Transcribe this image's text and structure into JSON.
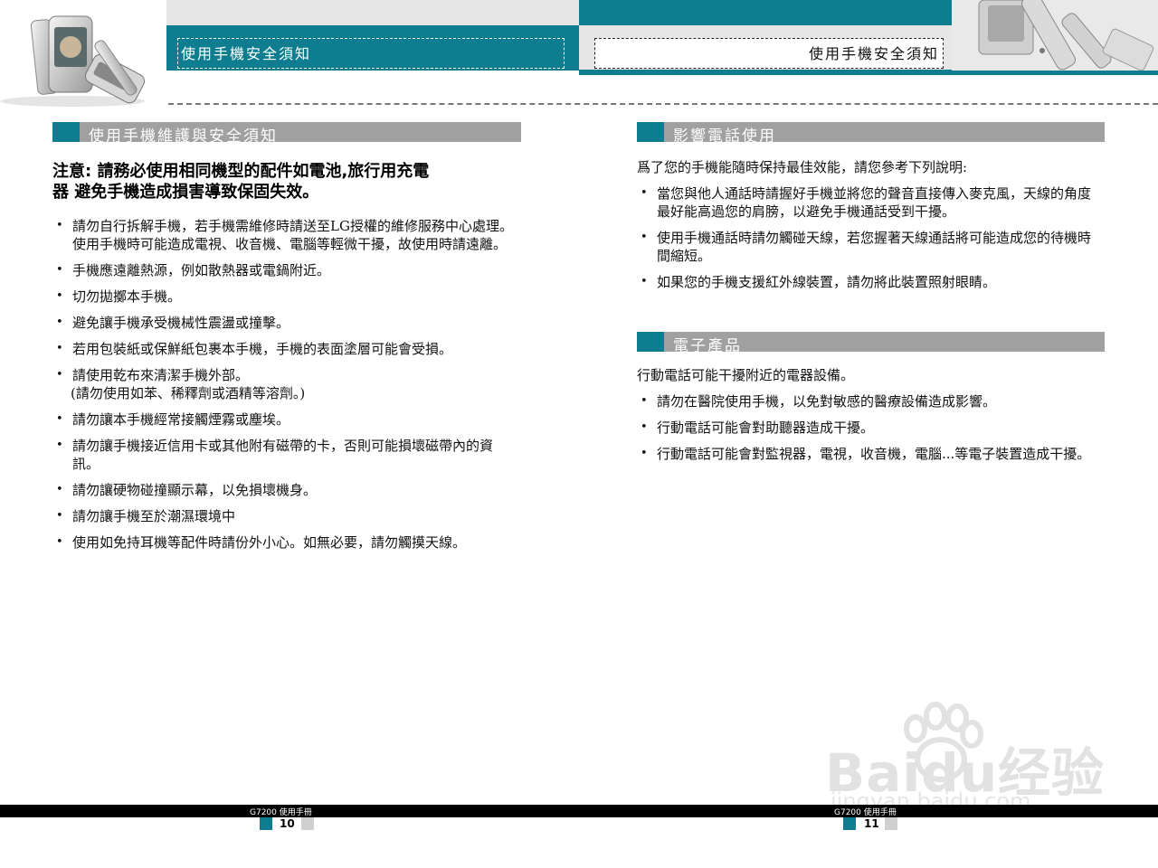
{
  "header": {
    "left_title": "使用手機安全須知",
    "right_title": "使用手機安全須知"
  },
  "left_page": {
    "section_title": "使用手機維護與安全須知",
    "notice_line1": "注意:  請務必使用相同機型的配件如電池,旅行用充電",
    "notice_line2": "器  避免手機造成損害導致保固失效。",
    "bullets": [
      "請勿自行拆解手機，若手機需維修時請送至LG授權的維修服務中心處理。使用手機時可能造成電視、收音機、電腦等輕微干擾，故使用時請遠離。",
      "手機應遠離熱源，例如散熱器或電鍋附近。",
      "切勿拋擲本手機。",
      "避免讓手機承受機械性震盪或撞擊。",
      "若用包裝紙或保鮮紙包裹本手機，手機的表面塗層可能會受損。",
      "請使用乾布來清潔手機外部。",
      "請勿讓本手機經常接觸煙霧或塵埃。",
      "請勿讓手機接近信用卡或其他附有磁帶的卡，否則可能損壞磁帶內的資訊。",
      "請勿讓硬物碰撞顯示幕，以免損壞機身。",
      "請勿讓手機至於潮濕環境中",
      "使用如免持耳機等配件時請份外小心。如無必要，請勿觸摸天線。"
    ],
    "bullet6_sub": "(請勿使用如苯、稀釋劑或酒精等溶劑。)"
  },
  "right_page": {
    "section1_title": "影響電話使用",
    "section1_intro": "爲了您的手機能隨時保持最佳效能，請您參考下列說明:",
    "section1_bullets": [
      "當您與他人通話時請握好手機並將您的聲音直接傳入麥克風，天線的角度最好能高過您的肩膀，以避免手機通話受到干擾。",
      "使用手機通話時請勿觸碰天線，若您握著天線通話將可能造成您的待機時間縮短。",
      "如果您的手機支援紅外線裝置，請勿將此裝置照射眼睛。"
    ],
    "section2_title": "電子產品",
    "section2_intro": "行動電話可能干擾附近的電器設備。",
    "section2_bullets": [
      "請勿在醫院使用手機，以免對敏感的醫療設備造成影響。",
      "行動電話可能會對助聽器造成干擾。",
      "行動電話可能會對監視器，電視，收音機，電腦...等電子裝置造成干擾。"
    ]
  },
  "footer": {
    "left_label": "G7200 使用手冊",
    "left_page_number": "10",
    "right_label": "G7200 使用手冊",
    "right_page_number": "11"
  },
  "watermark": {
    "brand": "Baidu经验",
    "url": "jingyan.baidu.com"
  },
  "colors": {
    "teal": "#0f7d90",
    "section_gray": "#a0a0a0",
    "header_gray": "#e6e6e6"
  }
}
